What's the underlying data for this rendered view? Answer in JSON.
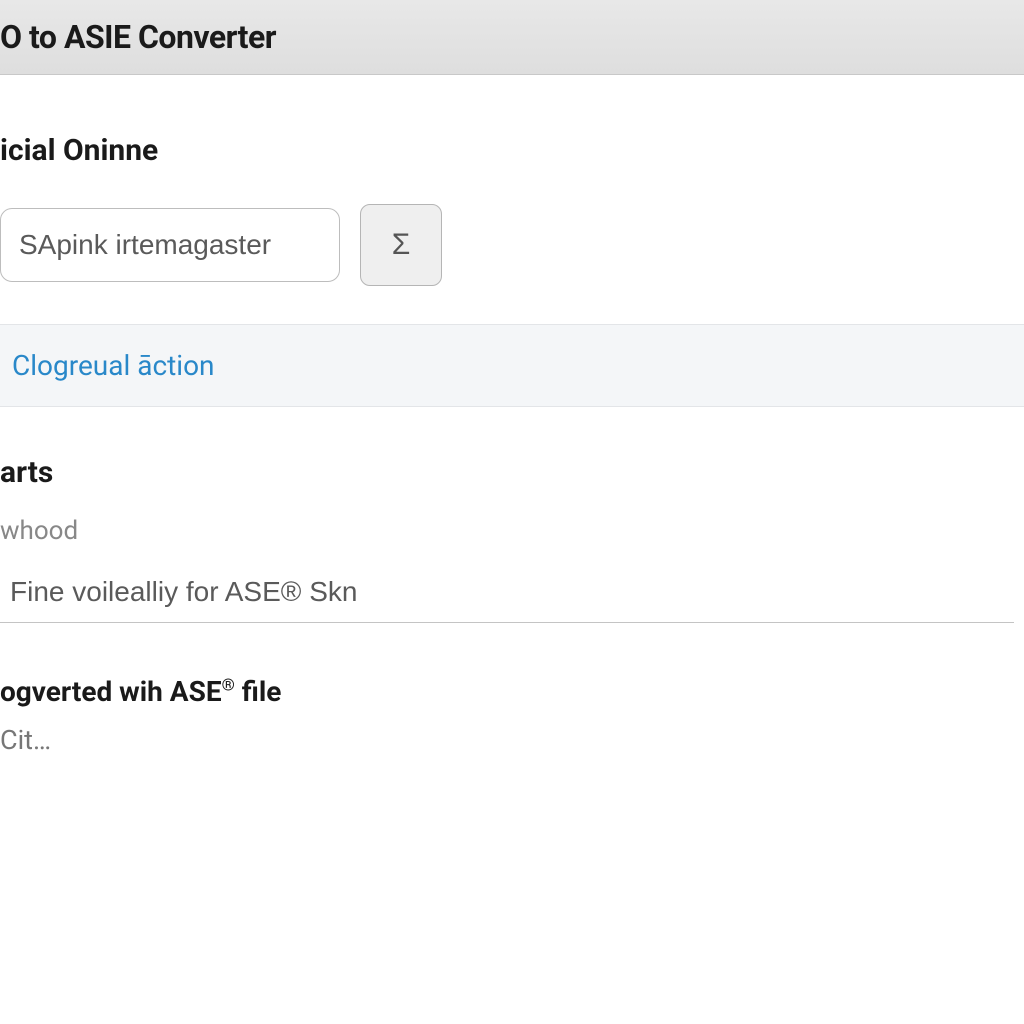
{
  "header": {
    "title": "O to ASIE Converter"
  },
  "main": {
    "heading1": "icial Oninne",
    "input1": {
      "value": "SApink irtemagaster"
    },
    "sigma_icon": "Σ",
    "action_link": "Clogreual āction",
    "heading2": "arts",
    "muted_label": "whood",
    "input2": {
      "value": "Fine voilealliy for ASE® Skn"
    },
    "file_heading_prefix": "ogverted wih ASE",
    "file_heading_suffix": " file",
    "file_sub": "Cit…"
  }
}
